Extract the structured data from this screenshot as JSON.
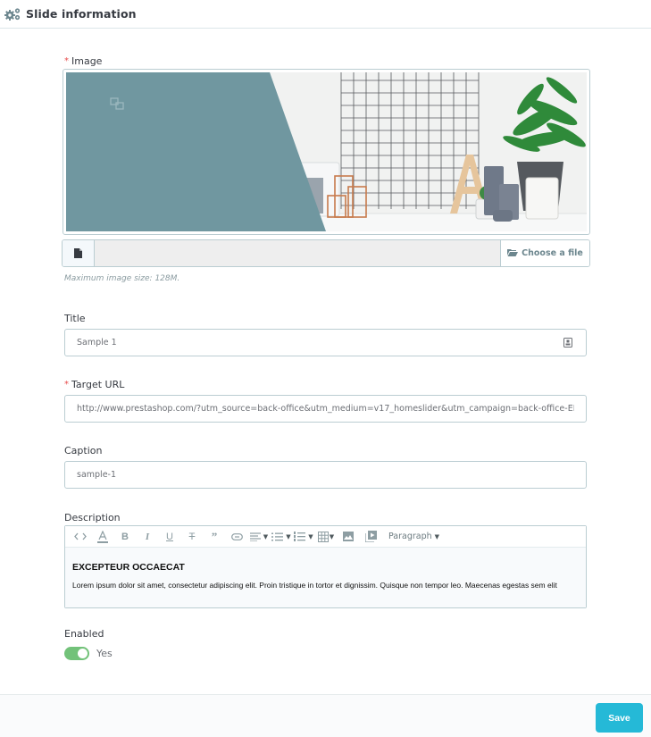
{
  "panel": {
    "title": "Slide information",
    "icon": "gears-icon"
  },
  "form": {
    "required_marker": "*",
    "image": {
      "label": "Image",
      "required": true,
      "choose_file_label": "Choose a file",
      "file_name": "",
      "help_text": "Maximum image size: 128M."
    },
    "title": {
      "label": "Title",
      "value": "Sample 1",
      "trailing_icon": "translation-icon"
    },
    "target_url": {
      "label": "Target URL",
      "required": true,
      "value": "http://www.prestashop.com/?utm_source=back-office&utm_medium=v17_homeslider&utm_campaign=back-office-EN&utm_content=download"
    },
    "caption": {
      "label": "Caption",
      "value": "sample-1"
    },
    "description": {
      "label": "Description",
      "toolbar": {
        "items": [
          "code",
          "text-color",
          "bold",
          "italic",
          "underline",
          "strikethrough",
          "blockquote",
          "link",
          "align",
          "bullet-list",
          "numbered-list",
          "table",
          "image",
          "media"
        ],
        "format_select": "Paragraph"
      },
      "heading": "EXCEPTEUR OCCAECAT",
      "body": "Lorem ipsum dolor sit amet, consectetur adipiscing elit. Proin tristique in tortor et dignissim. Quisque non tempor leo. Maecenas egestas sem elit"
    },
    "enabled": {
      "label": "Enabled",
      "value": true,
      "state_label": "Yes"
    }
  },
  "footer": {
    "save_label": "Save"
  },
  "colors": {
    "accent": "#25b9d7",
    "switch_on": "#72c279",
    "required": "#e84d4d",
    "border": "#bbcdd2"
  }
}
